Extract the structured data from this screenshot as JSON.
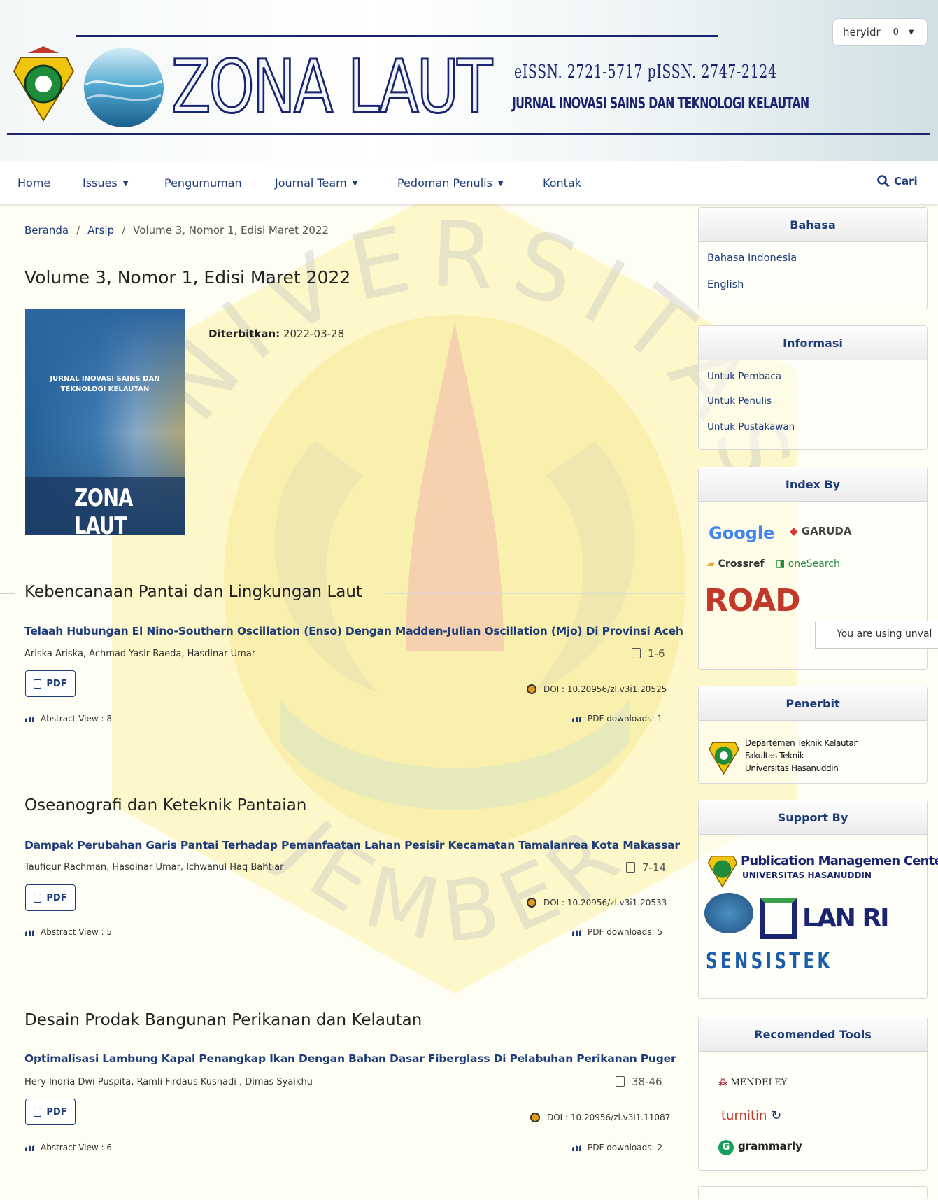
{
  "header": {
    "title": "ZONA LAUT",
    "issn": "eISSN. 2721-5717  pISSN. 2747-2124",
    "subtitle": "JURNAL INOVASI SAINS DAN TEKNOLOGI KELAUTAN",
    "user": {
      "name": "heryidr",
      "badge": "0"
    }
  },
  "nav": {
    "items": [
      {
        "label": "Home"
      },
      {
        "label": "Issues",
        "dropdown": true
      },
      {
        "label": "Pengumuman"
      },
      {
        "label": "Journal Team",
        "dropdown": true
      },
      {
        "label": "Pedoman Penulis",
        "dropdown": true
      },
      {
        "label": "Kontak"
      }
    ],
    "search_label": "Cari"
  },
  "breadcrumb": {
    "home": "Beranda",
    "archive": "Arsip",
    "current": "Volume 3, Nomor 1, Edisi Maret 2022"
  },
  "issue": {
    "title": "Volume 3, Nomor 1, Edisi Maret 2022",
    "published_label": "Diterbitkan:",
    "published_date": "2022-03-28",
    "cover": {
      "heading": "JURNAL INOVASI SAINS DAN TEKNOLOGI KELAUTAN",
      "logo": "ZONA LAUT"
    }
  },
  "sections": [
    {
      "title": "Kebencanaan Pantai dan Lingkungan Laut",
      "article": {
        "title": "Telaah Hubungan El Nino-Southern Oscillation (Enso) Dengan Madden-Julian Oscillation (Mjo) Di Provinsi Aceh",
        "authors": "Ariska Ariska, Achmad Yasir Baeda, Hasdinar Umar",
        "pages": "1-6",
        "pdf_label": "PDF",
        "doi": "DOI : 10.20956/zl.v3i1.20525",
        "abstract_views": "Abstract View : 8",
        "pdf_downloads": "PDF downloads: 1"
      }
    },
    {
      "title": "Oseanografi dan Keteknik Pantaian",
      "article": {
        "title": "Dampak Perubahan Garis Pantai Terhadap Pemanfaatan Lahan Pesisir Kecamatan Tamalanrea Kota Makassar",
        "authors": "Taufiqur Rachman, Hasdinar Umar, Ichwanul Haq Bahtiar",
        "pages": "7-14",
        "pdf_label": "PDF",
        "doi": "DOI : 10.20956/zl.v3i1.20533",
        "abstract_views": "Abstract View : 5",
        "pdf_downloads": "PDF downloads: 5"
      }
    },
    {
      "title": "Desain Prodak Bangunan Perikanan dan Kelautan",
      "article": {
        "title": "Optimalisasi Lambung Kapal Penangkap Ikan Dengan Bahan Dasar Fiberglass Di Pelabuhan Perikanan Puger",
        "authors": "Hery Indria Dwi Puspita, Ramli Firdaus Kusnadi , Dimas Syaikhu",
        "pages": "38-46",
        "pdf_label": "PDF",
        "doi": "DOI : 10.20956/zl.v3i1.11087",
        "abstract_views": "Abstract View : 6",
        "pdf_downloads": "PDF downloads: 2"
      }
    }
  ],
  "sidebar": {
    "bahasa": {
      "heading": "Bahasa",
      "links": [
        "Bahasa Indonesia",
        "English"
      ]
    },
    "informasi": {
      "heading": "Informasi",
      "links": [
        "Untuk Pembaca",
        "Untuk Penulis",
        "Untuk Pustakawan"
      ]
    },
    "index": {
      "heading": "Index By",
      "logos": [
        "Google",
        "GARUDA",
        "Crossref",
        "oneSearch",
        "ROAD"
      ]
    },
    "penerbit": {
      "heading": "Penerbit",
      "lines": [
        "Departemen Teknik Kelautan",
        "Fakultas Teknik",
        "Universitas Hasanuddin"
      ]
    },
    "support": {
      "heading": "Support By",
      "pmc_line1": "Publication Managemen Center",
      "pmc_line2": "UNIVERSITAS HASANUDDIN",
      "lan": "LAN RI",
      "sensistek": "SENSISTEK"
    },
    "tools": {
      "heading": "Recomended Tools",
      "items": [
        "MENDELEY",
        "turnitin",
        "grammarly"
      ]
    }
  },
  "tooltip": "You are using unval",
  "watermark": {
    "top": "UNIVERSITAS",
    "bottom": "JEMBER"
  },
  "colors": {
    "link": "#1d3c79",
    "brand": "#1a2470",
    "doi_dot": "#e39a1b",
    "watermark": "#f6d94a"
  }
}
